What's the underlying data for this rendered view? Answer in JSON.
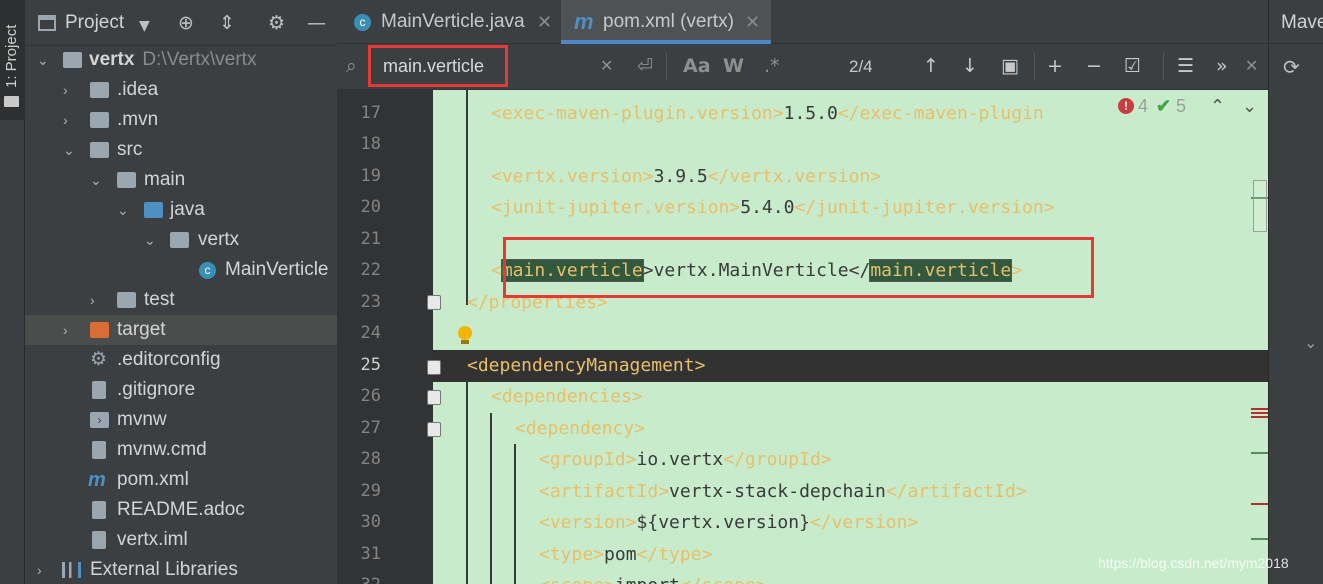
{
  "tool_strip": {
    "project_tab_label": "1: Project"
  },
  "project_panel": {
    "title": "Project",
    "tree": [
      {
        "label": "vertx",
        "sub": "D:\\Vertx\\vertx",
        "icon": "module-folder-icon"
      },
      {
        "label": ".idea",
        "icon": "folder-icon"
      },
      {
        "label": ".mvn",
        "icon": "folder-icon"
      },
      {
        "label": "src",
        "icon": "folder-icon"
      },
      {
        "label": "main",
        "icon": "folder-icon"
      },
      {
        "label": "java",
        "icon": "source-folder-icon"
      },
      {
        "label": "vertx",
        "icon": "package-icon"
      },
      {
        "label": "MainVerticle",
        "icon": "java-class-icon"
      },
      {
        "label": "test",
        "icon": "folder-icon"
      },
      {
        "label": "target",
        "icon": "excluded-folder-icon"
      },
      {
        "label": ".editorconfig",
        "icon": "settings-file-icon"
      },
      {
        "label": ".gitignore",
        "icon": "ignore-file-icon"
      },
      {
        "label": "mvnw",
        "icon": "shell-script-icon"
      },
      {
        "label": "mvnw.cmd",
        "icon": "text-file-icon"
      },
      {
        "label": "pom.xml",
        "icon": "maven-icon"
      },
      {
        "label": "README.adoc",
        "icon": "text-file-icon"
      },
      {
        "label": "vertx.iml",
        "icon": "iml-file-icon"
      },
      {
        "label": "External Libraries",
        "icon": "libraries-icon"
      }
    ]
  },
  "tabs": [
    {
      "label": "MainVerticle.java",
      "icon": "java-class-icon",
      "active": false
    },
    {
      "label": "pom.xml (vertx)",
      "icon": "maven-icon",
      "active": true
    }
  ],
  "search": {
    "query": "main.verticle",
    "match_count": "2/4"
  },
  "maven_panel": {
    "title": "Maven"
  },
  "editor": {
    "lines": [
      {
        "num": "17",
        "open": "<exec-maven-plugin.version>",
        "text": "1.5.0",
        "close": "</exec-maven-plugin"
      },
      {
        "num": "18"
      },
      {
        "num": "19",
        "open": "<vertx.version>",
        "text": "3.9.5",
        "close": "</vertx.version>"
      },
      {
        "num": "20",
        "open": "<junit-jupiter.version>",
        "text": "5.4.0",
        "close": "</junit-jupiter.version>"
      },
      {
        "num": "21"
      },
      {
        "num": "22",
        "open": "<",
        "hl1": "main.verticle",
        "mid": ">vertx.MainVerticle</",
        "hl2": "main.verticle",
        "close": ">"
      },
      {
        "num": "23",
        "close": "</properties>"
      },
      {
        "num": "24"
      },
      {
        "num": "25",
        "open": "<dependencyManagement>"
      },
      {
        "num": "26",
        "open": "<dependencies>"
      },
      {
        "num": "27",
        "open": "<dependency>"
      },
      {
        "num": "28",
        "open": "<groupId>",
        "text": "io.vertx",
        "close": "</groupId>"
      },
      {
        "num": "29",
        "open": "<artifactId>",
        "text": "vertx-stack-depchain",
        "close": "</artifactId>"
      },
      {
        "num": "30",
        "open": "<version>",
        "text": "${vertx.version}",
        "close": "</version>"
      },
      {
        "num": "31",
        "open": "<type>",
        "text": "pom",
        "close": "</type>"
      },
      {
        "num": "32",
        "open": "<scope>",
        "text": "import",
        "close": "</scope>"
      }
    ],
    "inspections": {
      "errors": "4",
      "ok": "5"
    }
  },
  "watermark": "https://blog.csdn.net/mym2018"
}
